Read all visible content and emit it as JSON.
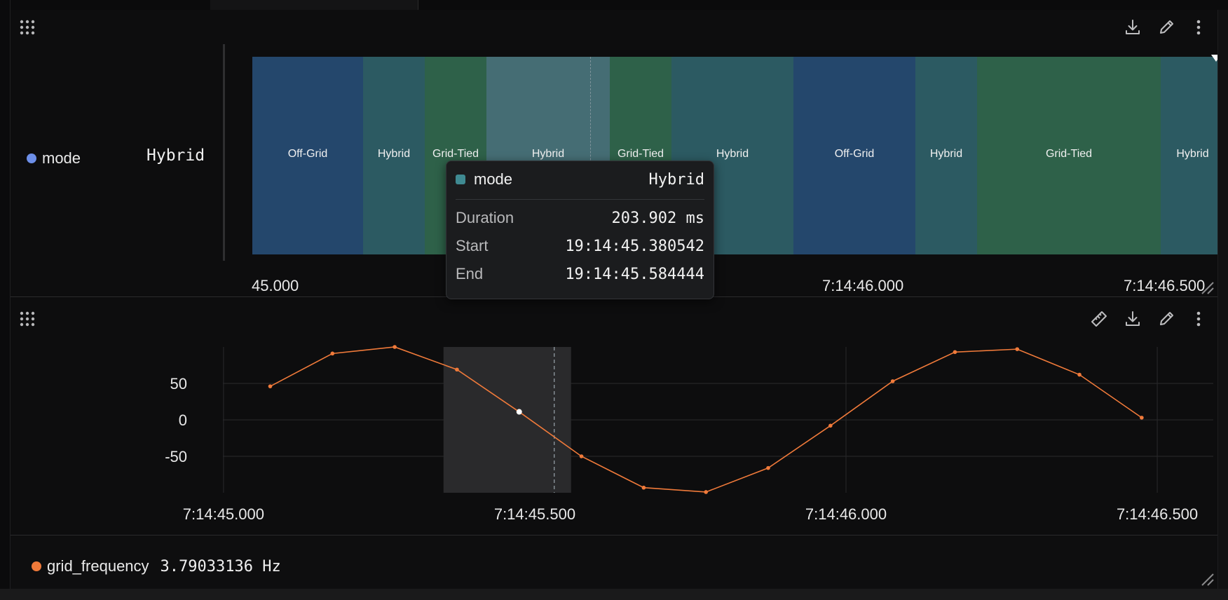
{
  "panel1": {
    "legend": {
      "label": "mode",
      "value": "Hybrid",
      "color": "#6d8fe8"
    },
    "bands": [
      {
        "label": "Off-Grid",
        "color": "#24476c"
      },
      {
        "label": "Hybrid",
        "color": "#2c5a62"
      },
      {
        "label": "Grid-Tied",
        "color": "#2e6149"
      },
      {
        "label": "Hybrid",
        "color": "#456d74"
      },
      {
        "label": "Grid-Tied",
        "color": "#2e6149"
      },
      {
        "label": "Hybrid",
        "color": "#2c5a62"
      },
      {
        "label": "Off-Grid",
        "color": "#24476c"
      },
      {
        "label": "Hybrid",
        "color": "#2c5a62"
      },
      {
        "label": "Grid-Tied",
        "color": "#2e6149"
      },
      {
        "label": "Hybrid",
        "color": "#2c5a62"
      }
    ],
    "x_ticks": [
      "45.000",
      "7:14:46.000",
      "7:14:46.500"
    ],
    "tooltip": {
      "series": "mode",
      "series_value": "Hybrid",
      "swatch_color": "#3f8a92",
      "rows": [
        {
          "key": "Duration",
          "value": "203.902 ms"
        },
        {
          "key": "Start",
          "value": "19:14:45.380542"
        },
        {
          "key": "End",
          "value": "19:14:45.584444"
        }
      ]
    },
    "icons": [
      "drag-handle-icon",
      "download-icon",
      "pencil-icon",
      "more-vertical-icon"
    ]
  },
  "panel2": {
    "y_ticks": [
      "50",
      "0",
      "-50"
    ],
    "x_ticks": [
      "7:14:45.000",
      "7:14:45.500",
      "7:14:46.000",
      "7:14:46.500"
    ],
    "line_color": "#f07a3a",
    "icons": [
      "drag-handle-icon",
      "ruler-icon",
      "download-icon",
      "pencil-icon",
      "more-vertical-icon"
    ]
  },
  "chart_data": {
    "type": "line",
    "x": [
      "7:14:45.075",
      "7:14:45.175",
      "7:14:45.275",
      "7:14:45.375",
      "7:14:45.475",
      "7:14:45.575",
      "7:14:45.675",
      "7:14:45.775",
      "7:14:45.875",
      "7:14:45.975",
      "7:14:46.075",
      "7:14:46.175",
      "7:14:46.275",
      "7:14:46.375",
      "7:14:46.475"
    ],
    "series": [
      {
        "name": "grid_frequency",
        "values": [
          46,
          91,
          100,
          69,
          11,
          -50,
          -93,
          -99,
          -66,
          -8,
          53,
          93,
          97,
          62,
          3
        ]
      }
    ],
    "xlim": [
      "7:14:44.999",
      "7:14:46.590"
    ],
    "ylim": [
      -100,
      100
    ],
    "grid": true,
    "highlight_x": "7:14:45.475"
  },
  "panel3": {
    "legend": {
      "label": "grid_frequency",
      "value": "3.79033136 Hz",
      "color": "#f07a3a"
    }
  }
}
